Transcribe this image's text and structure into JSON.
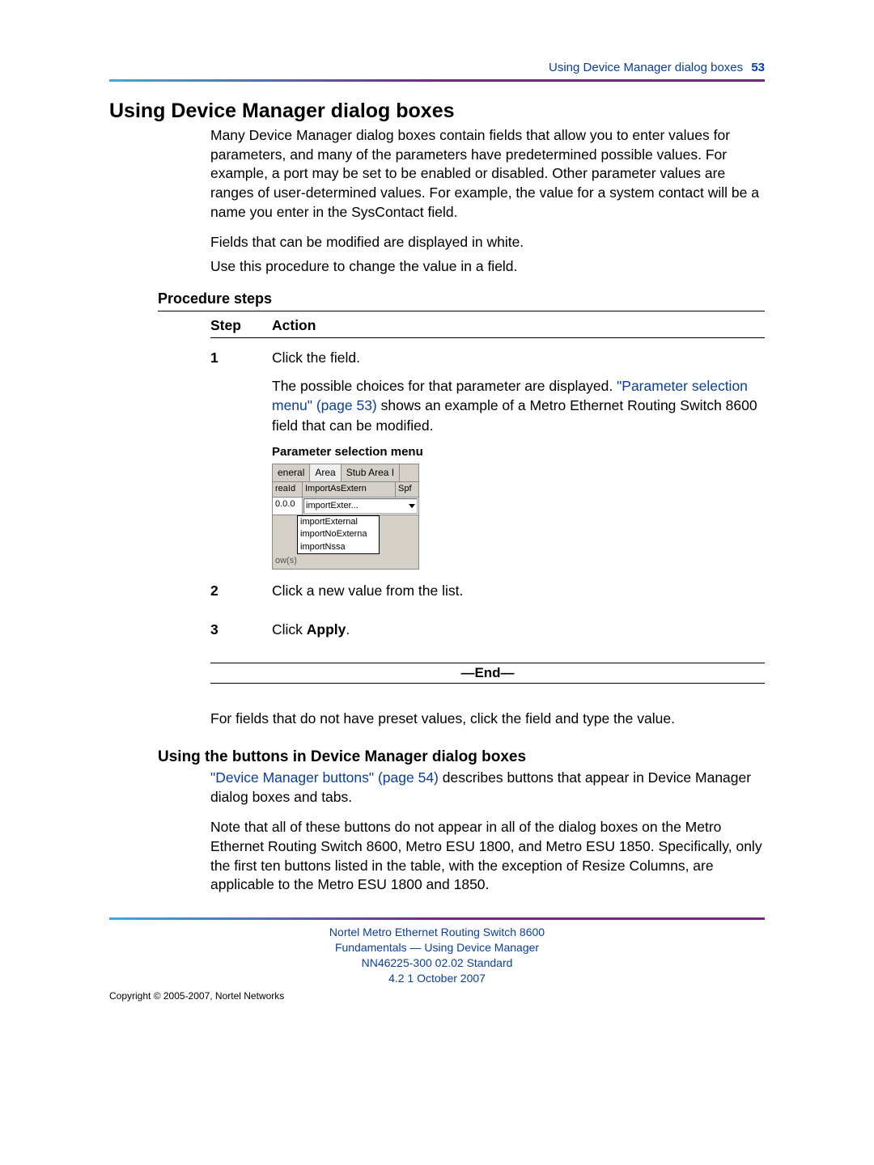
{
  "header": {
    "running_title": "Using Device Manager dialog boxes",
    "page_number": "53"
  },
  "section": {
    "title": "Using Device Manager dialog boxes",
    "intro_p1": "Many Device Manager dialog boxes contain fields that allow you to enter values for parameters, and many of the parameters have predetermined possible values. For example, a port may be set to be enabled or disabled. Other parameter values are ranges of user-determined values. For example, the value for a system contact will be a name you enter in the SysContact field.",
    "intro_p2": "Fields that can be modified are displayed in white.",
    "intro_p3": "Use this procedure to change the value in a field."
  },
  "procedure": {
    "heading": "Procedure steps",
    "col_step": "Step",
    "col_action": "Action",
    "steps": {
      "s1_num": "1",
      "s1_a": "Click the field.",
      "s1_b_pre": "The possible choices for that parameter are displayed. ",
      "s1_xref": "\"Parameter selection menu\" (page 53)",
      "s1_b_post": " shows an example of a Metro Ethernet Routing Switch 8600 field that can be modified.",
      "figcap": "Parameter selection menu",
      "shot": {
        "tab1": "eneral",
        "tab2": "Area",
        "tab3": "Stub Area I",
        "hdr1": "reaId",
        "hdr2": "ImportAsExtern",
        "hdr3": "Spf",
        "row_id": "0.0.0",
        "sel_val": "importExter...",
        "opt1": "importExternal",
        "opt2": "importNoExterna",
        "opt3": "importNssa",
        "footer": "ow(s)"
      },
      "s2_num": "2",
      "s2_a": "Click a new value from the list.",
      "s3_num": "3",
      "s3_a_pre": "Click ",
      "s3_a_bold": "Apply",
      "s3_a_post": "."
    },
    "end_label": "—End—",
    "tail_p": "For fields that do not have preset values, click the field and type the value."
  },
  "subsection": {
    "title": "Using the buttons in Device Manager dialog boxes",
    "p1_xref": "\"Device Manager buttons\" (page 54)",
    "p1_rest": " describes buttons that appear in Device Manager dialog boxes and tabs.",
    "p2": "Note that all of these buttons do not appear in all of the dialog boxes on the Metro Ethernet Routing Switch 8600, Metro ESU 1800, and Metro ESU 1850. Specifically, only the first ten buttons listed in the table, with the exception of Resize Columns, are applicable to the Metro ESU 1800 and 1850."
  },
  "footer": {
    "l1": "Nortel Metro Ethernet Routing Switch 8600",
    "l2": "Fundamentals — Using Device Manager",
    "l3": "NN46225-300   02.02   Standard",
    "l4": "4.2   1 October 2007",
    "copyright": "Copyright © 2005-2007, Nortel Networks"
  }
}
